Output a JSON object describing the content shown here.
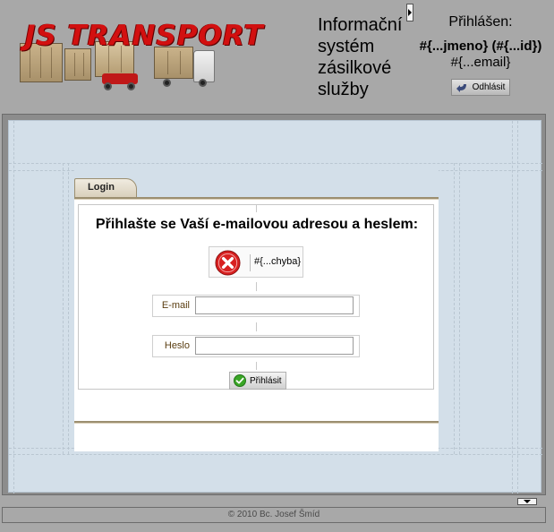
{
  "header": {
    "logo_text": "JS TRANSPORT",
    "title_lines": [
      "Informační",
      "systém",
      "zásilkové",
      "služby"
    ],
    "user": {
      "status": "Přihlášen:",
      "name": "#{...jmeno} (#{...id})",
      "email": "#{...email}",
      "logout_label": "Odhlásit"
    }
  },
  "login_panel": {
    "tab_label": "Login",
    "heading": "Přihlašte se Vaší e-mailovou adresou a heslem:",
    "error_message": "#{...chyba}",
    "email_label": "E-mail",
    "email_value": "",
    "password_label": "Heslo",
    "password_value": "",
    "submit_label": "Přihlásit"
  },
  "footer": {
    "text": "© 2010 Bc. Josef Šmíd"
  },
  "icons": {
    "error": "error-x-icon",
    "submit": "checkmark-icon",
    "logout": "logout-arrow-icon"
  },
  "colors": {
    "logo_red": "#d21010",
    "page_bg": "#a8a8a8",
    "content_bg": "#d3dfe9",
    "error_red": "#d82020",
    "ok_green": "#3aa626"
  }
}
